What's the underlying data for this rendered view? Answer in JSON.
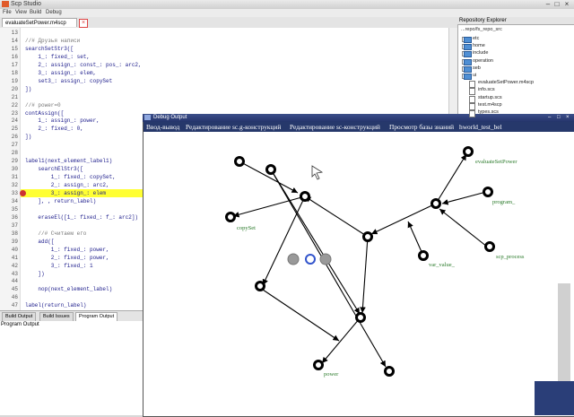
{
  "app": {
    "title": "Scp Studio"
  },
  "menu": [
    "File",
    "View",
    "Build",
    "Debug"
  ],
  "editor": {
    "tab_label": "evaluateSetPower.m4scp",
    "lines": [
      {
        "n": "13",
        "text": ""
      },
      {
        "n": "14",
        "text": "//# Друзья написи",
        "comment": true
      },
      {
        "n": "15",
        "text": "searchSetStr3(["
      },
      {
        "n": "16",
        "text": "    1_: fixed_: set,"
      },
      {
        "n": "17",
        "text": "    2_: assign_: const_: pos_: arc2,"
      },
      {
        "n": "18",
        "text": "    3_: assign_: elem,"
      },
      {
        "n": "19",
        "text": "    set3_: assign_: copySet"
      },
      {
        "n": "20",
        "text": "])"
      },
      {
        "n": "21",
        "text": ""
      },
      {
        "n": "22",
        "text": "//# power=0",
        "comment": true
      },
      {
        "n": "23",
        "text": "contAssign(["
      },
      {
        "n": "24",
        "text": "    1_: assign_: power,"
      },
      {
        "n": "25",
        "text": "    2_: fixed_: 0,"
      },
      {
        "n": "26",
        "text": "])"
      },
      {
        "n": "27",
        "text": ""
      },
      {
        "n": "28",
        "text": ""
      },
      {
        "n": "29",
        "text": "label1(next_element_label1)"
      },
      {
        "n": "30",
        "text": "    searchElStr3(["
      },
      {
        "n": "31",
        "text": "        1_: fixed_: copySet,"
      },
      {
        "n": "32",
        "text": "        2_: assign_: arc2,"
      },
      {
        "n": "33",
        "text": "        3_: assign_: elem"
      },
      {
        "n": "34",
        "text": "    ], , return_label)"
      },
      {
        "n": "35",
        "text": ""
      },
      {
        "n": "36",
        "text": "    eraseEl([1_: fixed_: f_: arc2])"
      },
      {
        "n": "37",
        "text": ""
      },
      {
        "n": "38",
        "text": "    //# Считаем его",
        "comment": true
      },
      {
        "n": "39",
        "text": "    add(["
      },
      {
        "n": "40",
        "text": "        1_: fixed_: power,"
      },
      {
        "n": "41",
        "text": "        2_: fixed_: power,"
      },
      {
        "n": "42",
        "text": "        3_: fixed_: 1"
      },
      {
        "n": "43",
        "text": "    ])"
      },
      {
        "n": "44",
        "text": ""
      },
      {
        "n": "45",
        "text": "    nop(next_element_label)"
      },
      {
        "n": "46",
        "text": ""
      },
      {
        "n": "47",
        "text": "label(return_label)"
      }
    ]
  },
  "bottom_tabs": [
    "Build Output",
    "Build Issues",
    "Program Output"
  ],
  "output_label": "Program Output",
  "repo": {
    "header": "Repository Explorer",
    "path": "...repo/fs_repo_src",
    "items": [
      {
        "label": "etc",
        "type": "folder"
      },
      {
        "label": "home",
        "type": "folder"
      },
      {
        "label": "include",
        "type": "folder"
      },
      {
        "label": "operation",
        "type": "folder"
      },
      {
        "label": "seb",
        "type": "folder"
      },
      {
        "label": "ui",
        "type": "folder"
      },
      {
        "label": "evaluateSetPower.m4scp",
        "type": "file"
      },
      {
        "label": "info.scs",
        "type": "file"
      },
      {
        "label": "startup.scs",
        "type": "file"
      },
      {
        "label": "test.m4scp",
        "type": "file"
      },
      {
        "label": "types.scs",
        "type": "file"
      }
    ]
  },
  "debug": {
    "title": "Debug Output",
    "menu": [
      "Ввод-вывод",
      "Редактирование sc.g-конструкций",
      "Редактирование sc-конструкций",
      "Просмотр базы знаний",
      "hworld_test_bel"
    ],
    "node_labels": {
      "evaluate": "evaluateSetPower",
      "copyset": "copySet",
      "program": "program_",
      "var_value": "var_value_",
      "scp_process": "scp_process",
      "power": "power"
    }
  },
  "colors": {
    "accent": "#26386b",
    "highlight": "#ffff33",
    "label_green": "#2a7a2a"
  }
}
